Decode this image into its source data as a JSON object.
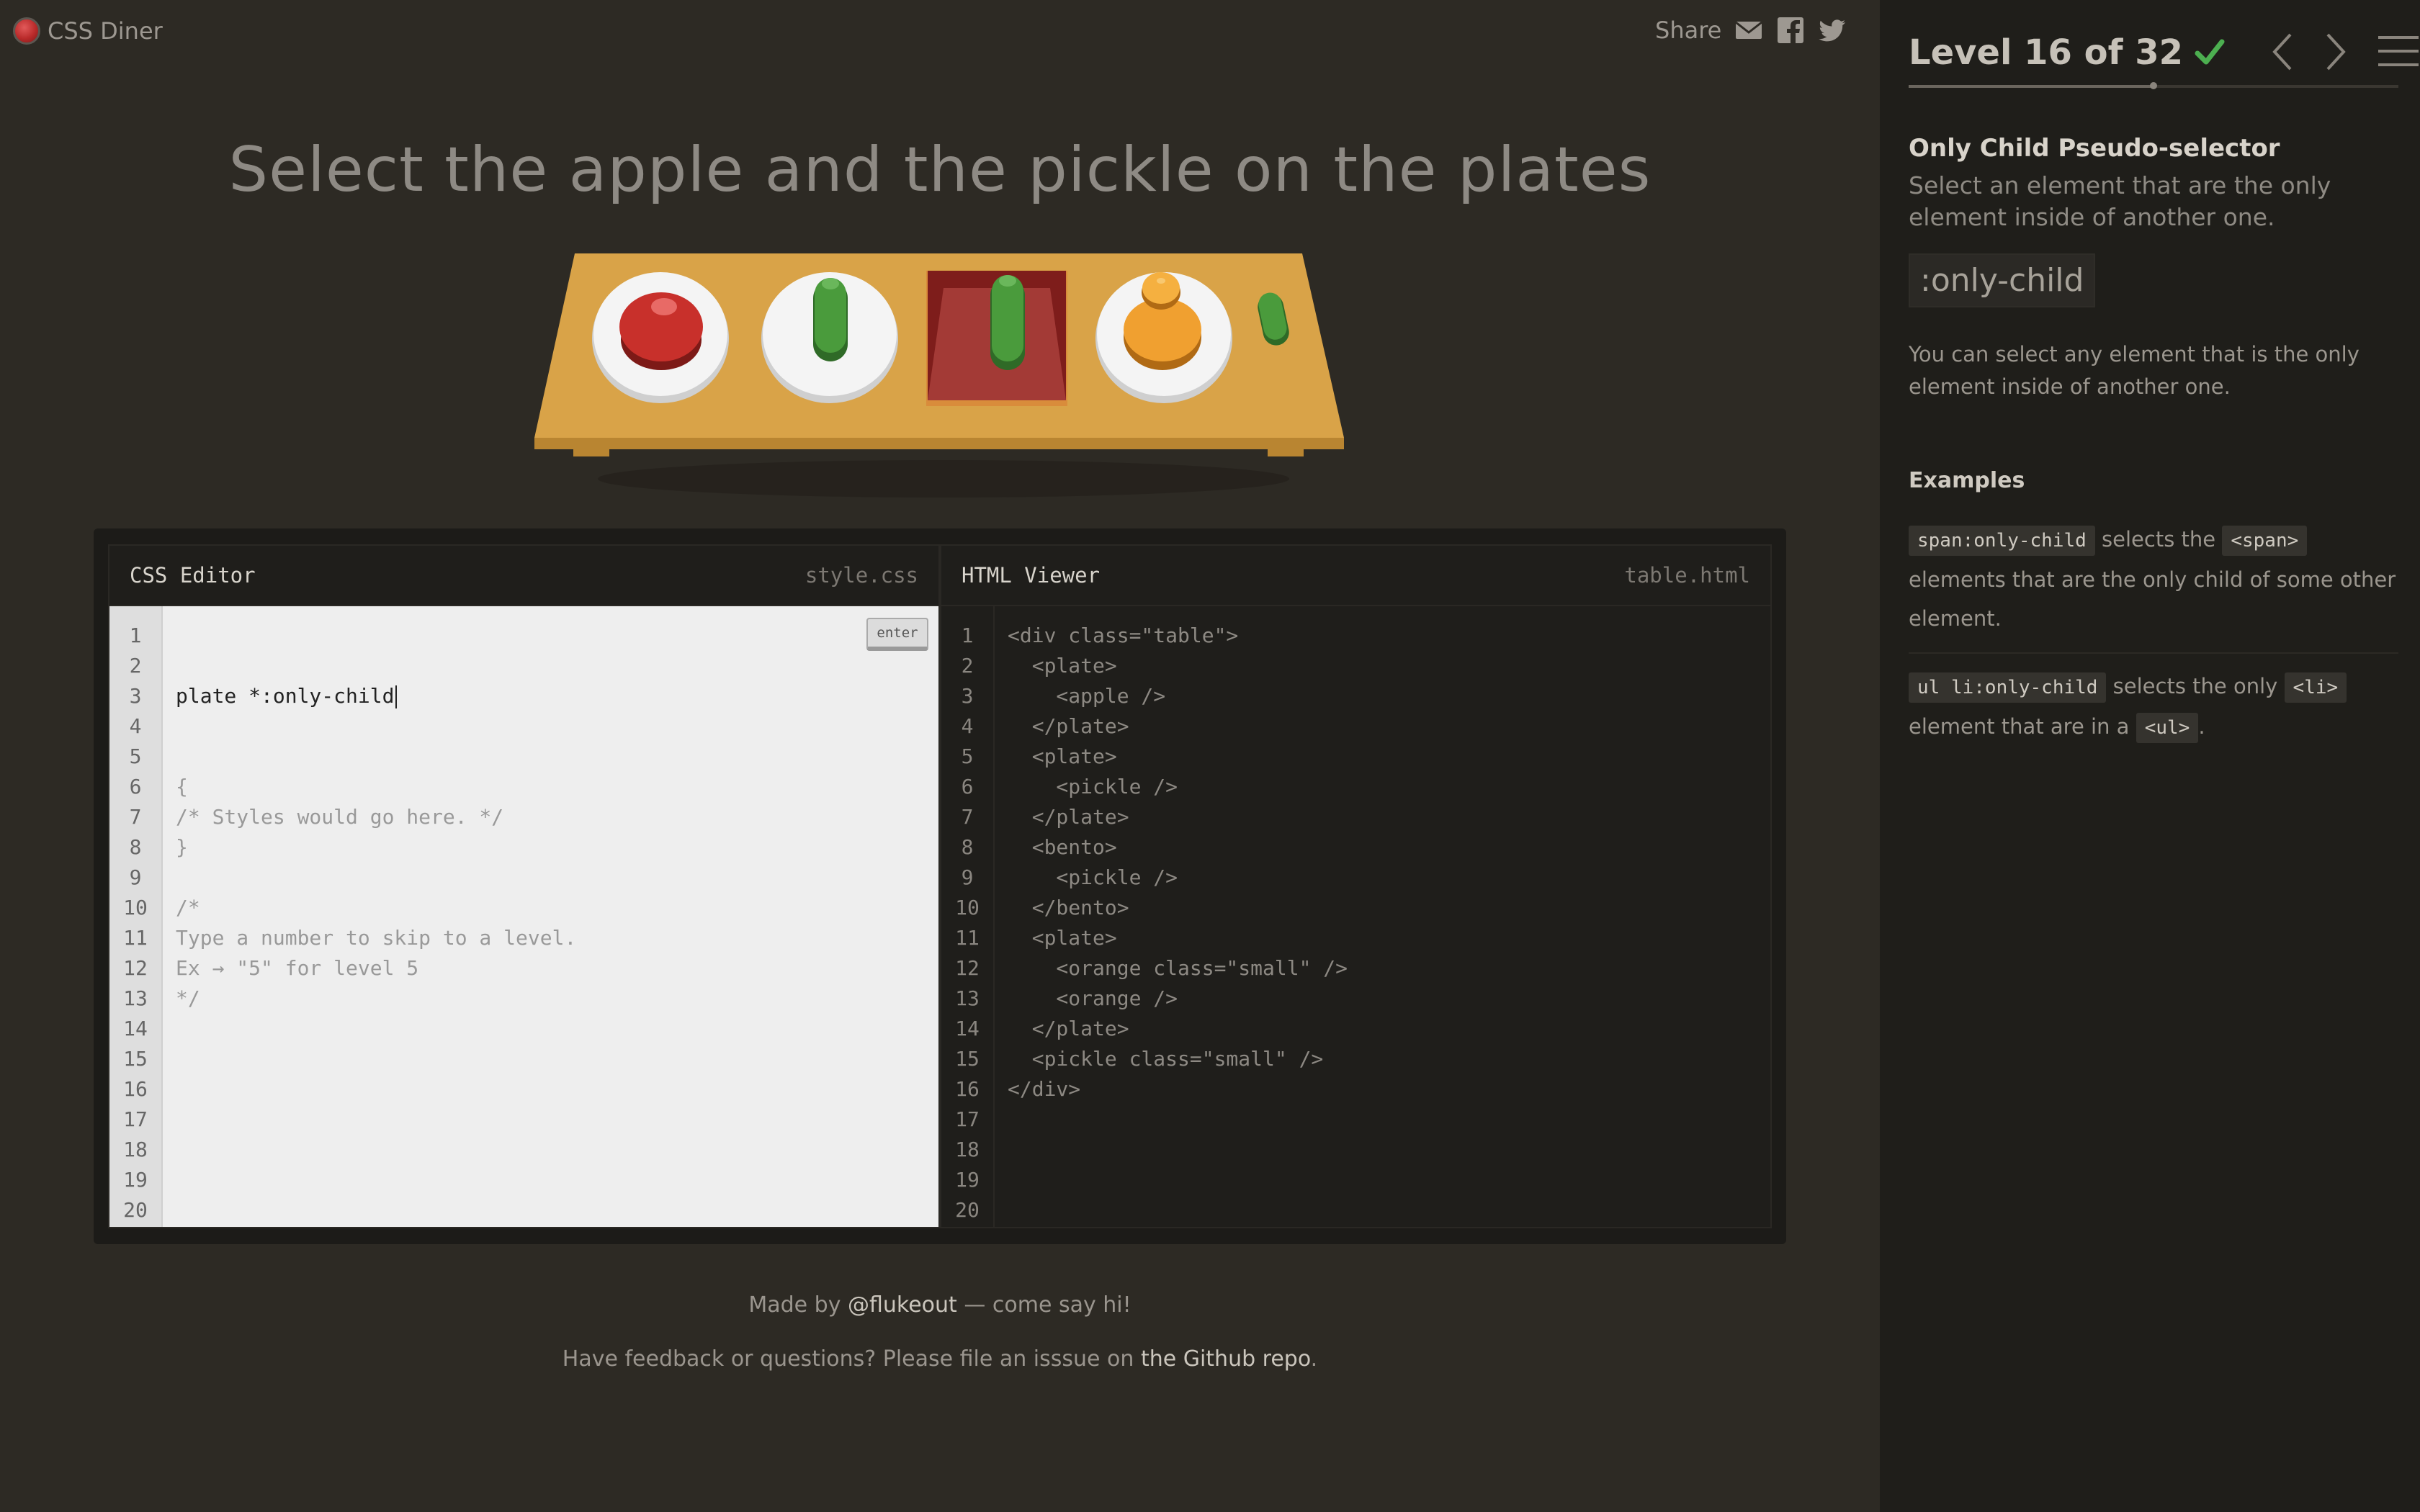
{
  "app": {
    "name": "CSS Diner",
    "share_label": "Share"
  },
  "game": {
    "instruction": "Select the apple and the pickle on the plates"
  },
  "css_editor": {
    "title": "CSS Editor",
    "filename": "style.css",
    "input_value": "plate *:only-child",
    "enter_label": "enter",
    "lines": [
      "{",
      "/* Styles would go here. */",
      "}",
      "",
      "/*",
      "Type a number to skip to a level.",
      "Ex → \"5\" for level 5",
      "*/"
    ],
    "line_count": 20
  },
  "html_viewer": {
    "title": "HTML Viewer",
    "filename": "table.html",
    "lines": [
      "<div class=\"table\">",
      "  <plate>",
      "    <apple />",
      "  </plate>",
      "  <plate>",
      "    <pickle />",
      "  </plate>",
      "  <bento>",
      "    <pickle />",
      "  </bento>",
      "  <plate>",
      "    <orange class=\"small\" />",
      "    <orange />",
      "  </plate>",
      "  <pickle class=\"small\" />",
      "</div>"
    ],
    "line_count": 20
  },
  "footer": {
    "made_by_prefix": "Made by ",
    "made_by_link": "@flukeout",
    "made_by_suffix": " — come say hi!",
    "feedback_prefix": "Have feedback or questions? Please file an isssue on ",
    "feedback_link": "the Github repo",
    "feedback_suffix": "."
  },
  "sidebar": {
    "level_text": "Level 16 of 32",
    "level_completed": true,
    "progress": 0.5,
    "selector_name": "Only Child Pseudo-selector",
    "selector_title": "Select an element that are the only element inside of another one.",
    "syntax": ":only-child",
    "help": "You can select any element that is the only element inside of another one.",
    "examples_title": "Examples",
    "examples": [
      {
        "code": "span:only-child",
        "text1": " selects the ",
        "tag": "<span>",
        "text2": " elements that are the only child of some other element."
      },
      {
        "code": "ul li:only-child",
        "text1": " selects the only ",
        "tag": "<li>",
        "text2": " element that are in a ",
        "tag2": "<ul>",
        "text3": "."
      }
    ]
  },
  "colors": {
    "background": "#2d2a24",
    "sidebar": "#1f1e1a",
    "table_wood": "#d9a348",
    "check_green": "#4caf50",
    "apple_red": "#c8302b",
    "pickle_green": "#4a9b3c",
    "orange": "#f0a030",
    "bento": "#a12d2a"
  },
  "icons": {
    "logo": "css-diner-logo-icon",
    "email": "email-icon",
    "facebook": "facebook-icon",
    "twitter": "twitter-icon",
    "check": "check-icon",
    "prev": "chevron-left-icon",
    "next": "chevron-right-icon",
    "menu": "hamburger-menu-icon"
  }
}
